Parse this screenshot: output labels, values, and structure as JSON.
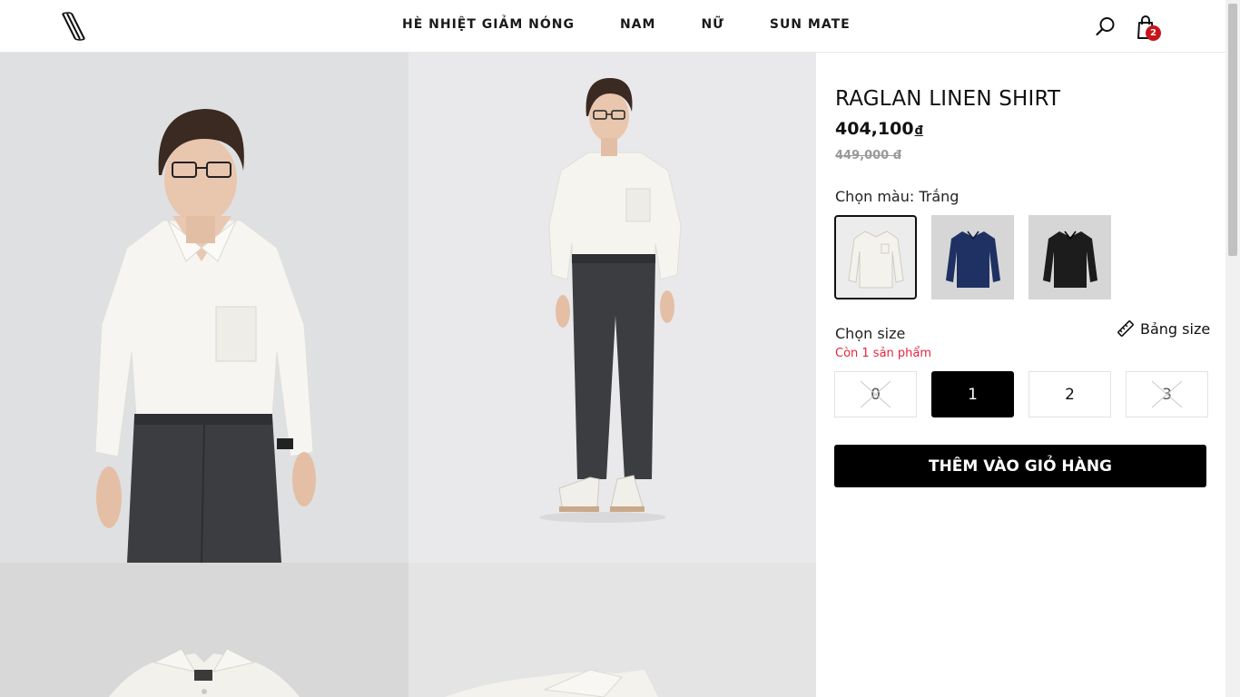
{
  "nav": {
    "items": [
      "HÈ NHIỆT GIẢM NÓNG",
      "NAM",
      "NỮ",
      "SUN MATE"
    ]
  },
  "cart": {
    "count": "2"
  },
  "product": {
    "title": "RAGLAN LINEN SHIRT",
    "price": "404,100",
    "currency": "đ",
    "old_price": "449,000 đ",
    "color_label": "Chọn màu: Trắng",
    "colors": [
      {
        "name": "Trắng",
        "hex": "#f2f0ea",
        "selected": true
      },
      {
        "name": "Xanh navy",
        "hex": "#1e3162",
        "selected": false
      },
      {
        "name": "Đen",
        "hex": "#1a1a1a",
        "selected": false
      }
    ],
    "size_label": "Chọn size",
    "size_guide": "Bảng size",
    "stock_note": "Còn 1 sản phẩm",
    "sizes": [
      {
        "label": "0",
        "state": "disabled"
      },
      {
        "label": "1",
        "state": "active"
      },
      {
        "label": "2",
        "state": "available"
      },
      {
        "label": "3",
        "state": "disabled"
      }
    ],
    "add_to_cart": "THÊM VÀO GIỎ HÀNG"
  },
  "colors": {
    "accent": "#000000",
    "badge": "#c8151b",
    "stock_warning": "#e8243c"
  },
  "icons": [
    "logo-icon",
    "search-icon",
    "cart-icon",
    "ruler-icon"
  ]
}
